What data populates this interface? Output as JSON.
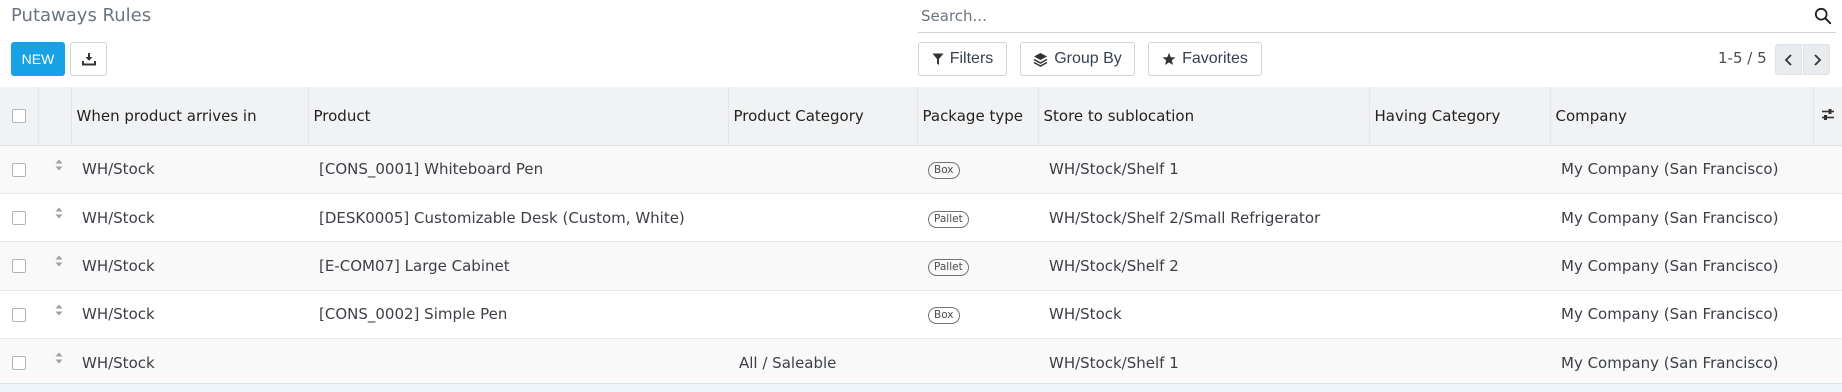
{
  "header": {
    "title": "Putaways Rules"
  },
  "search": {
    "placeholder": "Search..."
  },
  "toolbar": {
    "new_label": "NEW",
    "filters_label": "Filters",
    "group_by_label": "Group By",
    "favorites_label": "Favorites"
  },
  "pager": {
    "value": "1-5 / 5"
  },
  "table": {
    "columns": [
      "When product arrives in",
      "Product",
      "Product Category",
      "Package type",
      "Store to sublocation",
      "Having Category",
      "Company"
    ],
    "rows": [
      {
        "arrives_in": "WH/Stock",
        "product": "[CONS_0001] Whiteboard Pen",
        "category": "",
        "package": "Box",
        "sublocation": "WH/Stock/Shelf 1",
        "having_category": "",
        "company": "My Company (San Francisco)"
      },
      {
        "arrives_in": "WH/Stock",
        "product": "[DESK0005] Customizable Desk (Custom, White)",
        "category": "",
        "package": "Pallet",
        "sublocation": "WH/Stock/Shelf 2/Small Refrigerator",
        "having_category": "",
        "company": "My Company (San Francisco)"
      },
      {
        "arrives_in": "WH/Stock",
        "product": "[E-COM07] Large Cabinet",
        "category": "",
        "package": "Pallet",
        "sublocation": "WH/Stock/Shelf 2",
        "having_category": "",
        "company": "My Company (San Francisco)"
      },
      {
        "arrives_in": "WH/Stock",
        "product": "[CONS_0002] Simple Pen",
        "category": "",
        "package": "Box",
        "sublocation": "WH/Stock",
        "having_category": "",
        "company": "My Company (San Francisco)"
      },
      {
        "arrives_in": "WH/Stock",
        "product": "",
        "category": "All / Saleable",
        "package": "",
        "sublocation": "WH/Stock/Shelf 1",
        "having_category": "",
        "company": "My Company (San Francisco)"
      }
    ]
  },
  "icons": {
    "search": "search-icon",
    "download": "download-icon",
    "filter": "filter-icon",
    "group": "layers-icon",
    "favorite": "star-icon",
    "prev": "chevron-left-icon",
    "next": "chevron-right-icon",
    "optional_columns": "sliders-icon",
    "row_handle": "drag-handle-icon"
  },
  "colors": {
    "primary": "#17a2e5",
    "header_bg": "#f1f2f4"
  }
}
